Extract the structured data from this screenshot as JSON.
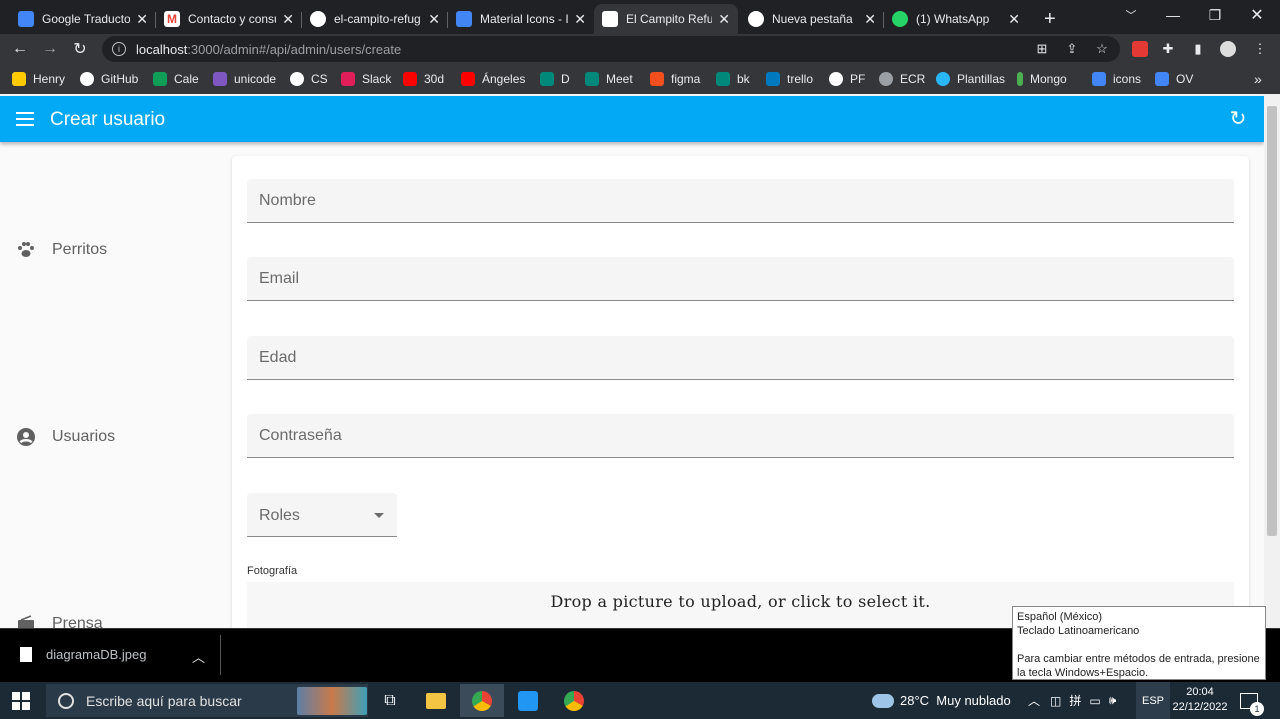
{
  "browser": {
    "tabs": [
      {
        "title": "Google Traductor",
        "icon": "google-translate-icon",
        "color": "#4285f4"
      },
      {
        "title": "Contacto y consu",
        "icon": "gmail-icon",
        "color": "#ea4335"
      },
      {
        "title": "el-campito-refug",
        "icon": "github-icon",
        "color": "#ffffff"
      },
      {
        "title": "Material Icons - I",
        "icon": "material-icons-icon",
        "color": "#4285f4"
      },
      {
        "title": "El Campito Refug",
        "icon": "el-campito-icon",
        "color": "#ffffff"
      },
      {
        "title": "Nueva pestaña",
        "icon": "chrome-icon",
        "color": "#ffffff"
      },
      {
        "title": "(1) WhatsApp",
        "icon": "whatsapp-icon",
        "color": "#25d366"
      }
    ],
    "active_tab_index": 4,
    "url_host": "localhost",
    "url_path": ":3000/admin#/api/admin/users/create",
    "bookmarks": [
      {
        "label": "Henry",
        "color": "#ffcc00"
      },
      {
        "label": "GitHub",
        "color": "#ffffff"
      },
      {
        "label": "Cale",
        "color": "#0f9d58"
      },
      {
        "label": "unicode",
        "color": "#7e57c2"
      },
      {
        "label": "CS",
        "color": "#ffffff"
      },
      {
        "label": "Slack",
        "color": "#e01e5a"
      },
      {
        "label": "30d",
        "color": "#ff0000"
      },
      {
        "label": "Ángeles",
        "color": "#ff0000"
      },
      {
        "label": "D",
        "color": "#00897b"
      },
      {
        "label": "Meet",
        "color": "#00897b"
      },
      {
        "label": "figma",
        "color": "#f24e1e"
      },
      {
        "label": "bk",
        "color": "#00897b"
      },
      {
        "label": "trello",
        "color": "#0079bf"
      },
      {
        "label": "PF",
        "color": "#ffffff"
      },
      {
        "label": "ECR",
        "color": "#9aa0a6"
      },
      {
        "label": "Plantillas",
        "color": "#29b6f6"
      },
      {
        "label": "Mongo",
        "color": "#4caf50"
      },
      {
        "label": "icons",
        "color": "#4285f4"
      },
      {
        "label": "OV",
        "color": "#4285f4"
      }
    ]
  },
  "app": {
    "title": "Crear usuario",
    "accent": "#03a9f4",
    "sidebar": [
      {
        "label": "Perritos",
        "icon": "paw-icon"
      },
      {
        "label": "Usuarios",
        "icon": "account-circle-icon"
      },
      {
        "label": "Prensa",
        "icon": "radio-icon"
      }
    ],
    "form": {
      "fields": [
        {
          "placeholder": "Nombre",
          "value": ""
        },
        {
          "placeholder": "Email",
          "value": ""
        },
        {
          "placeholder": "Edad",
          "value": ""
        },
        {
          "placeholder": "Contraseña",
          "value": ""
        }
      ],
      "roles_label": "Roles",
      "photo_label": "Fotografía",
      "dropzone_text": "Drop a picture to upload, or click to select it."
    }
  },
  "downloads": {
    "file_name": "diagramaDB.jpeg"
  },
  "ime_tooltip": {
    "line1": "Español (México)",
    "line2": "Teclado Latinoamericano",
    "line3": "Para cambiar entre métodos de entrada, presione la tecla Windows+Espacio."
  },
  "taskbar": {
    "search_placeholder": "Escribe aquí para buscar",
    "weather": "28°C  Muy nublado",
    "language": "ESP",
    "time": "20:04",
    "date": "22/12/2022",
    "notification_count": "1"
  }
}
